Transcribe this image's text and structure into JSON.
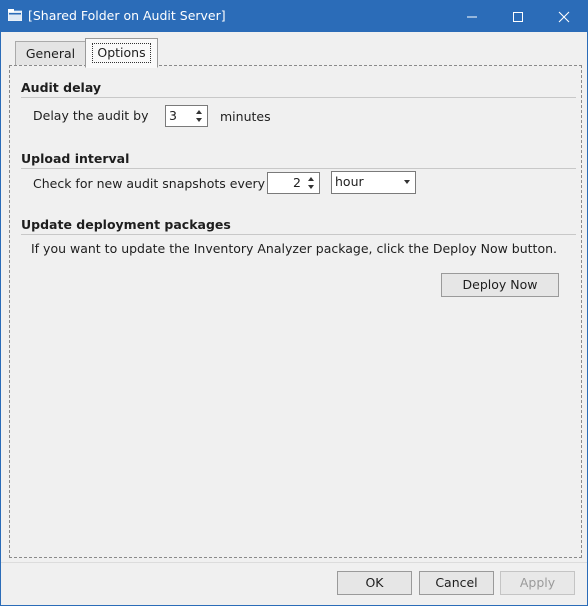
{
  "window": {
    "title": "[Shared Folder on Audit Server]",
    "accent_color": "#2b6cb8",
    "controls": [
      "minimize-icon",
      "maximize-icon",
      "close-icon"
    ]
  },
  "tabs": [
    {
      "label": "General",
      "selected": false
    },
    {
      "label": "Options",
      "selected": true
    }
  ],
  "audit_delay": {
    "heading": "Audit delay",
    "prefix": "Delay the audit by",
    "value": "3",
    "suffix": "minutes"
  },
  "upload_interval": {
    "heading": "Upload interval",
    "prefix": "Check for new audit snapshots every",
    "value": "2",
    "unit_selected": "hour"
  },
  "update_packages": {
    "heading": "Update deployment packages",
    "description": "If you want to update the Inventory Analyzer package, click the Deploy Now button.",
    "deploy_label": "Deploy Now"
  },
  "footer": {
    "ok_label": "OK",
    "cancel_label": "Cancel",
    "apply_label": "Apply",
    "apply_enabled": false
  }
}
